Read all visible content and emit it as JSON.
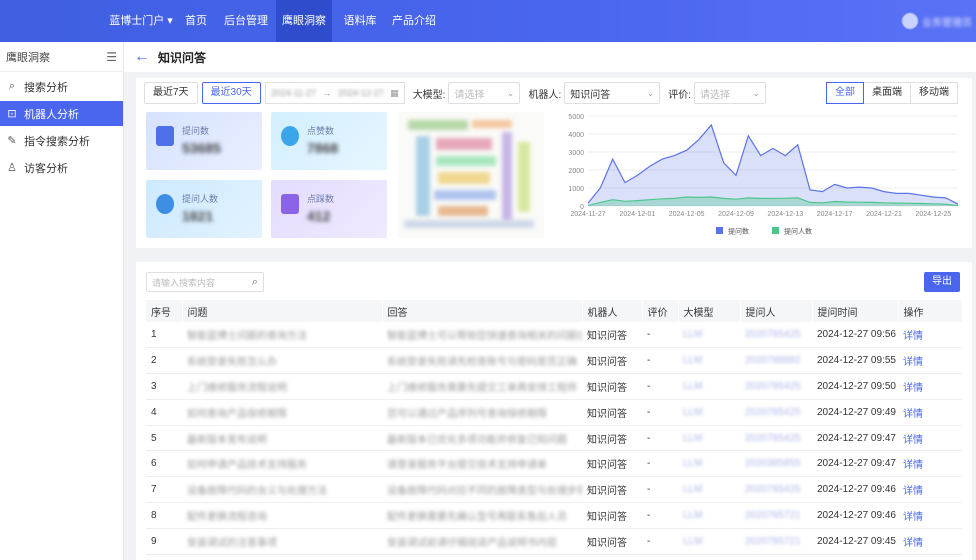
{
  "nav": {
    "items": [
      {
        "label": "蓝博士门户 ▾"
      },
      {
        "label": "首页"
      },
      {
        "label": "后台管理"
      },
      {
        "label": "鹰眼洞察"
      },
      {
        "label": "语料库"
      },
      {
        "label": "产品介绍"
      }
    ],
    "active_index": 3,
    "user": "业务管理员"
  },
  "sidebar": {
    "title": "鹰眼洞察",
    "items": [
      {
        "label": "搜索分析",
        "icon": "search-icon"
      },
      {
        "label": "机器人分析",
        "icon": "robot-icon",
        "active": true
      },
      {
        "label": "指令搜索分析",
        "icon": "edit-icon"
      },
      {
        "label": "访客分析",
        "icon": "user-icon"
      }
    ]
  },
  "page": {
    "title": "知识问答"
  },
  "filters": {
    "last7": "最近7天",
    "last30": "最近30天",
    "date_start": "2024-11-27",
    "date_sep": "→",
    "date_end": "2024-12-27",
    "model_label": "大模型:",
    "model_placeholder": "请选择",
    "robot_label": "机器人:",
    "robot_value": "知识问答",
    "rating_label": "评价:",
    "rating_placeholder": "请选择",
    "segments": [
      "全部",
      "桌面端",
      "移动端"
    ]
  },
  "stats": [
    {
      "label": "提问数",
      "value": "53685"
    },
    {
      "label": "点赞数",
      "value": "7868"
    },
    {
      "label": "提问人数",
      "value": "1821"
    },
    {
      "label": "点踩数",
      "value": "412"
    }
  ],
  "chart_data": {
    "type": "area",
    "x_ticks": [
      "2024-11-27",
      "2024-12-01",
      "2024-12-05",
      "2024-12-09",
      "2024-12-13",
      "2024-12-17",
      "2024-12-21",
      "2024-12-25"
    ],
    "y_ticks": [
      "5000",
      "4000",
      "3000",
      "2000",
      "1000",
      "0"
    ],
    "ylim": [
      0,
      5000
    ],
    "series": [
      {
        "name": "提问数",
        "color": "#5b73e8",
        "values": [
          150,
          1000,
          2600,
          1300,
          1700,
          2200,
          2600,
          2800,
          3100,
          3700,
          4500,
          2400,
          1700,
          3900,
          2800,
          3200,
          2800,
          3400,
          900,
          800,
          1200,
          1000,
          1050,
          1000,
          800,
          700,
          700,
          600,
          500,
          450,
          100
        ]
      },
      {
        "name": "提问人数",
        "color": "#4cc78a",
        "values": [
          20,
          200,
          350,
          260,
          300,
          350,
          400,
          420,
          500,
          480,
          500,
          420,
          380,
          450,
          420,
          430,
          430,
          450,
          200,
          180,
          250,
          220,
          210,
          200,
          180,
          160,
          150,
          140,
          120,
          100,
          20
        ]
      }
    ],
    "grid": true,
    "legend": "bottom"
  },
  "table": {
    "search_placeholder": "请输入搜索内容",
    "export_label": "导出",
    "columns": [
      "序号",
      "问题",
      "回答",
      "机器人",
      "评价",
      "大模型",
      "提问人",
      "提问时间",
      "操作"
    ],
    "rows": [
      {
        "no": "1",
        "q": "智能蓝博士问题的查询方法",
        "a": "智能蓝博士可以帮助您快速查询相关的问题信息",
        "robot": "知识问答",
        "rating": "-",
        "model": "LLM",
        "user": "2020785425",
        "time": "2024-12-27 09:56",
        "op": "详情"
      },
      {
        "no": "2",
        "q": "系统登录失败怎么办",
        "a": "系统登录失败请先检查账号与密码是否正确",
        "robot": "知识问答",
        "rating": "-",
        "model": "LLM",
        "user": "2020788882",
        "time": "2024-12-27 09:55",
        "op": "详情"
      },
      {
        "no": "3",
        "q": "上门维修服务流程说明",
        "a": "上门维修服务需要先提交工单再安排工程师",
        "robot": "知识问答",
        "rating": "-",
        "model": "LLM",
        "user": "2020785425",
        "time": "2024-12-27 09:50",
        "op": "详情"
      },
      {
        "no": "4",
        "q": "如何查询产品保修期限",
        "a": "您可以通过产品序列号查询保修期限",
        "robot": "知识问答",
        "rating": "-",
        "model": "LLM",
        "user": "2020785425",
        "time": "2024-12-27 09:49",
        "op": "详情"
      },
      {
        "no": "5",
        "q": "最新版本发布说明",
        "a": "最新版本已优化多项功能并修复已知问题",
        "robot": "知识问答",
        "rating": "-",
        "model": "LLM",
        "user": "2020785425",
        "time": "2024-12-27 09:47",
        "op": "详情"
      },
      {
        "no": "6",
        "q": "如何申请产品技术支持服务",
        "a": "请登录服务平台提交技术支持申请单",
        "robot": "知识问答",
        "rating": "-",
        "model": "LLM",
        "user": "2020385855",
        "time": "2024-12-27 09:47",
        "op": "详情"
      },
      {
        "no": "7",
        "q": "设备故障代码的含义与处理方法",
        "a": "设备故障代码对应不同的故障类型与处理步骤",
        "robot": "知识问答",
        "rating": "-",
        "model": "LLM",
        "user": "2020785425",
        "time": "2024-12-27 09:46",
        "op": "详情"
      },
      {
        "no": "8",
        "q": "配件更换流程咨询",
        "a": "配件更换需要先确认型号再联系售后人员",
        "robot": "知识问答",
        "rating": "-",
        "model": "LLM",
        "user": "2020785721",
        "time": "2024-12-27 09:46",
        "op": "详情"
      },
      {
        "no": "9",
        "q": "安装调试的注意事项",
        "a": "安装调试前请仔细阅读产品说明书内容",
        "robot": "知识问答",
        "rating": "-",
        "model": "LLM",
        "user": "2020785721",
        "time": "2024-12-27 09:45",
        "op": "详情"
      }
    ]
  }
}
